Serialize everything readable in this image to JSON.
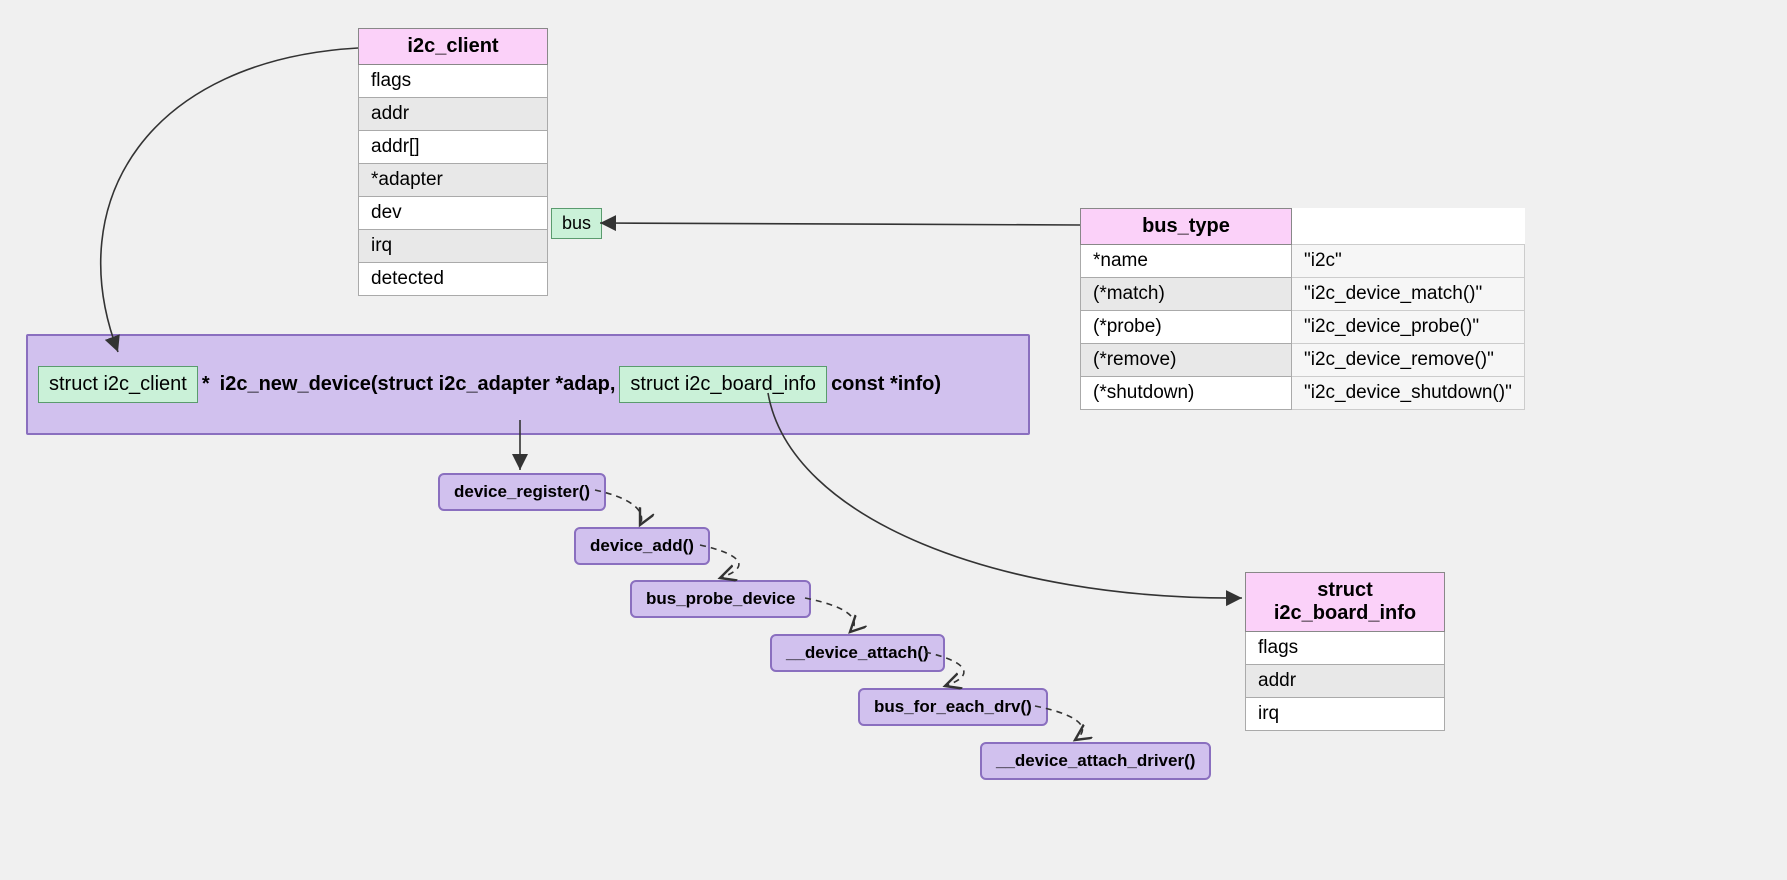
{
  "i2c_client": {
    "title": "i2c_client",
    "fields": [
      "flags",
      "addr",
      "addr[]",
      "*adapter",
      "dev",
      "irq",
      "detected"
    ]
  },
  "bus_tag": "bus",
  "bus_type": {
    "title": "bus_type",
    "rows": [
      {
        "field": "*name",
        "value": "\"i2c\""
      },
      {
        "field": "(*match)",
        "value": "\"i2c_device_match()\""
      },
      {
        "field": "(*probe)",
        "value": "\"i2c_device_probe()\""
      },
      {
        "field": "(*remove)",
        "value": "\"i2c_device_remove()\""
      },
      {
        "field": "(*shutdown)",
        "value": "\"i2c_device_shutdown()\""
      }
    ]
  },
  "func": {
    "return_type": "struct i2c_client",
    "star": "*",
    "name_part1": "i2c_new_device(struct i2c_adapter *adap,",
    "param_struct": "struct i2c_board_info",
    "name_part2": "const *info)"
  },
  "calls": [
    "device_register()",
    "device_add()",
    "bus_probe_device",
    "__device_attach()",
    "bus_for_each_drv()",
    "__device_attach_driver()"
  ],
  "board_info": {
    "title_line1": "struct",
    "title_line2": "i2c_board_info",
    "fields": [
      "flags",
      "addr",
      "irq"
    ]
  }
}
